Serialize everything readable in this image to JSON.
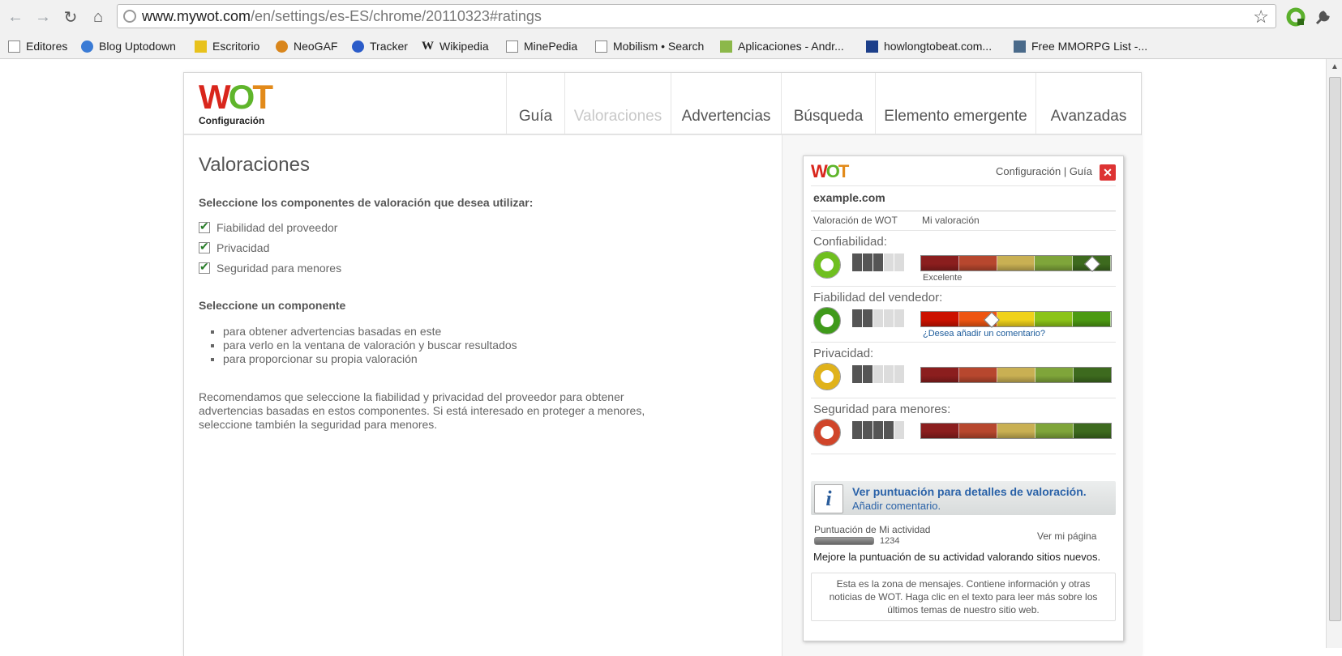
{
  "browser": {
    "url_host": "www.mywot.com",
    "url_path": "/en/settings/es-ES/chrome/20110323#ratings",
    "bookmarks": [
      {
        "label": "Editores"
      },
      {
        "label": "Blog Uptodown"
      },
      {
        "label": "Escritorio"
      },
      {
        "label": "NeoGAF"
      },
      {
        "label": "Tracker"
      },
      {
        "label": "Wikipedia"
      },
      {
        "label": "MinePedia"
      },
      {
        "label": "Mobilism • Search"
      },
      {
        "label": "Aplicaciones - Andr..."
      },
      {
        "label": "howlongtobeat.com..."
      },
      {
        "label": "Free MMORPG List -..."
      }
    ]
  },
  "header": {
    "logo": "WOT",
    "subtitle": "Configuración",
    "tabs": [
      {
        "label": "Guía",
        "active": false
      },
      {
        "label": "Valoraciones",
        "active": true
      },
      {
        "label": "Advertencias",
        "active": false
      },
      {
        "label": "Búsqueda",
        "active": false
      },
      {
        "label": "Elemento emergente",
        "active": false
      },
      {
        "label": "Avanzadas",
        "active": false
      }
    ]
  },
  "main": {
    "title": "Valoraciones",
    "select_components_heading": "Seleccione los componentes de valoración que desea utilizar:",
    "components": [
      {
        "label": "Fiabilidad del proveedor",
        "checked": true
      },
      {
        "label": "Privacidad",
        "checked": true
      },
      {
        "label": "Seguridad para menores",
        "checked": true
      }
    ],
    "select_one_heading": "Seleccione un componente",
    "bullets": [
      "para obtener advertencias basadas en este",
      "para verlo en la ventana de valoración y buscar resultados",
      "para proporcionar su propia valoración"
    ],
    "recommendation": [
      "Recomendamos que seleccione la fiabilidad y privacidad del proveedor para obtener",
      "advertencias basadas en estos componentes. Si está interesado en proteger a menores,",
      "seleccione también la seguridad para menores."
    ]
  },
  "popup": {
    "logo": "WOT",
    "links": "Configuración | Guía",
    "site": "example.com",
    "col_wot": "Valoración de WOT",
    "col_mine": "Mi valoración",
    "ratings": [
      {
        "label": "Confiabilidad:",
        "donut_color": "#6fbf1f",
        "confidence": 3,
        "marker": 0.9,
        "caption": "Excelente",
        "bar": "dim"
      },
      {
        "label": "Fiabilidad del vendedor:",
        "donut_color": "#3f9a1a",
        "confidence": 2,
        "marker": 0.37,
        "caption": "¿Desea añadir un comentario?",
        "bar": "bright"
      },
      {
        "label": "Privacidad:",
        "donut_color": "#e0b21a",
        "confidence": 2,
        "marker": null,
        "caption": "",
        "bar": "dim"
      },
      {
        "label": "Seguridad para menores:",
        "donut_color": "#d0452a",
        "confidence": 4,
        "marker": null,
        "caption": "",
        "bar": "dim"
      }
    ],
    "info_title": "Ver puntuación para detalles de valoración.",
    "info_link": "Añadir comentario.",
    "activity_label": "Puntuación de Mi actividad",
    "my_page_link": "Ver mi página",
    "activity_score": "1234",
    "activity_tip": "Mejore la puntuación de su actividad valorando sitios nuevos.",
    "message": "Esta es la zona de mensajes. Contiene información y otras noticias de WOT. Haga clic en el texto para leer más sobre los últimos temas de nuestro sitio web."
  },
  "colors": {
    "dim_segments": [
      "#8b1e1e",
      "#b7472e",
      "#c9b053",
      "#7fa53a",
      "#3d6a1e"
    ],
    "bright_segments": [
      "#cc1100",
      "#ee5511",
      "#f0d21a",
      "#8cc418",
      "#4c9a12"
    ]
  }
}
